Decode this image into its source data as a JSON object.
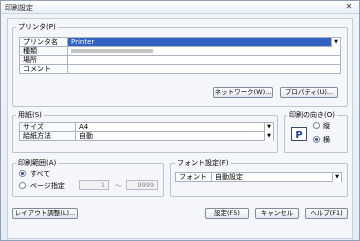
{
  "window": {
    "title": "印刷設定",
    "close_glyph": "✕"
  },
  "printer": {
    "group_label": "プリンタ(P)",
    "rows": [
      {
        "label": "プリンタ名",
        "value": "Printer"
      },
      {
        "label": "種類",
        "value": ""
      },
      {
        "label": "場所",
        "value": ""
      },
      {
        "label": "コメント",
        "value": ""
      }
    ],
    "network_button": "ネットワーク(W)...",
    "properties_button": "プロパティ(U)..."
  },
  "paper": {
    "group_label": "用紙(S)",
    "rows": [
      {
        "label": "サイズ",
        "value": "A4"
      },
      {
        "label": "給紙方法",
        "value": "自動"
      }
    ]
  },
  "orientation": {
    "group_label": "印刷の向き(O)",
    "options": [
      {
        "label": "縦",
        "selected": false
      },
      {
        "label": "横",
        "selected": true
      }
    ]
  },
  "range": {
    "group_label": "印刷範囲(A)",
    "all_label": "すべて",
    "pages_label": "ページ指定",
    "from": "1",
    "separator": "～",
    "to": "9999",
    "selected": "all"
  },
  "font": {
    "group_label": "フォント設定(F)",
    "row_label": "フォント",
    "value": "自動設定"
  },
  "footer": {
    "layout_button": "レイアウト調整(L)...",
    "settings_button": "設定(F5)",
    "cancel_button": "キャンセル",
    "help_button": "ヘルプ(F1)"
  },
  "colors": {
    "selection": "#3162c4",
    "border": "#a8b4c4",
    "background": "#f4f6f9"
  }
}
